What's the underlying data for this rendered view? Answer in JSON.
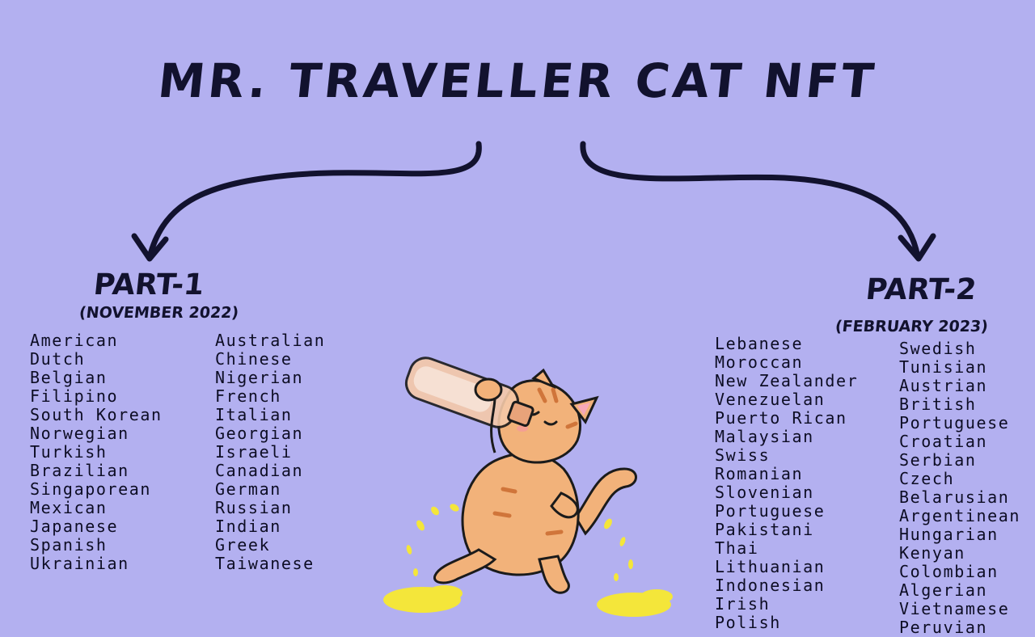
{
  "title": "MR. TRAVELLER CAT NFT",
  "part1": {
    "label": "PART-1",
    "date": "(NOVEMBER 2022)",
    "columns": [
      [
        "American",
        "Dutch",
        "Belgian",
        "Filipino",
        "South Korean",
        "Norwegian",
        "Turkish",
        "Brazilian",
        "Singaporean",
        "Mexican",
        "Japanese",
        "Spanish",
        "Ukrainian"
      ],
      [
        "Australian",
        "Chinese",
        "Nigerian",
        "French",
        "Italian",
        "Georgian",
        "Israeli",
        "Canadian",
        "German",
        "Russian",
        "Indian",
        "Greek",
        "Taiwanese"
      ]
    ]
  },
  "part2": {
    "label": "PART-2",
    "date": "(FEBRUARY 2023)",
    "columns": [
      [
        "Lebanese",
        "Moroccan",
        "New Zealander",
        "Venezuelan",
        "Puerto Rican",
        "Malaysian",
        "Swiss",
        "Romanian",
        "Slovenian",
        "Portuguese",
        "Pakistani",
        "Thai",
        "Lithuanian",
        "Indonesian",
        "Irish",
        "Polish"
      ],
      [
        "Swedish",
        "Tunisian",
        "Austrian",
        "British",
        "Portuguese",
        "Croatian",
        "Serbian",
        "Czech",
        "Belarusian",
        "Argentinean",
        "Hungarian",
        "Kenyan",
        "Colombian",
        "Algerian",
        "Vietnamese",
        "Peruvian"
      ]
    ]
  },
  "colors": {
    "background": "#b3b0f0",
    "ink": "#12122e",
    "cat": "#f2b27a",
    "puddle": "#f4e63a"
  }
}
